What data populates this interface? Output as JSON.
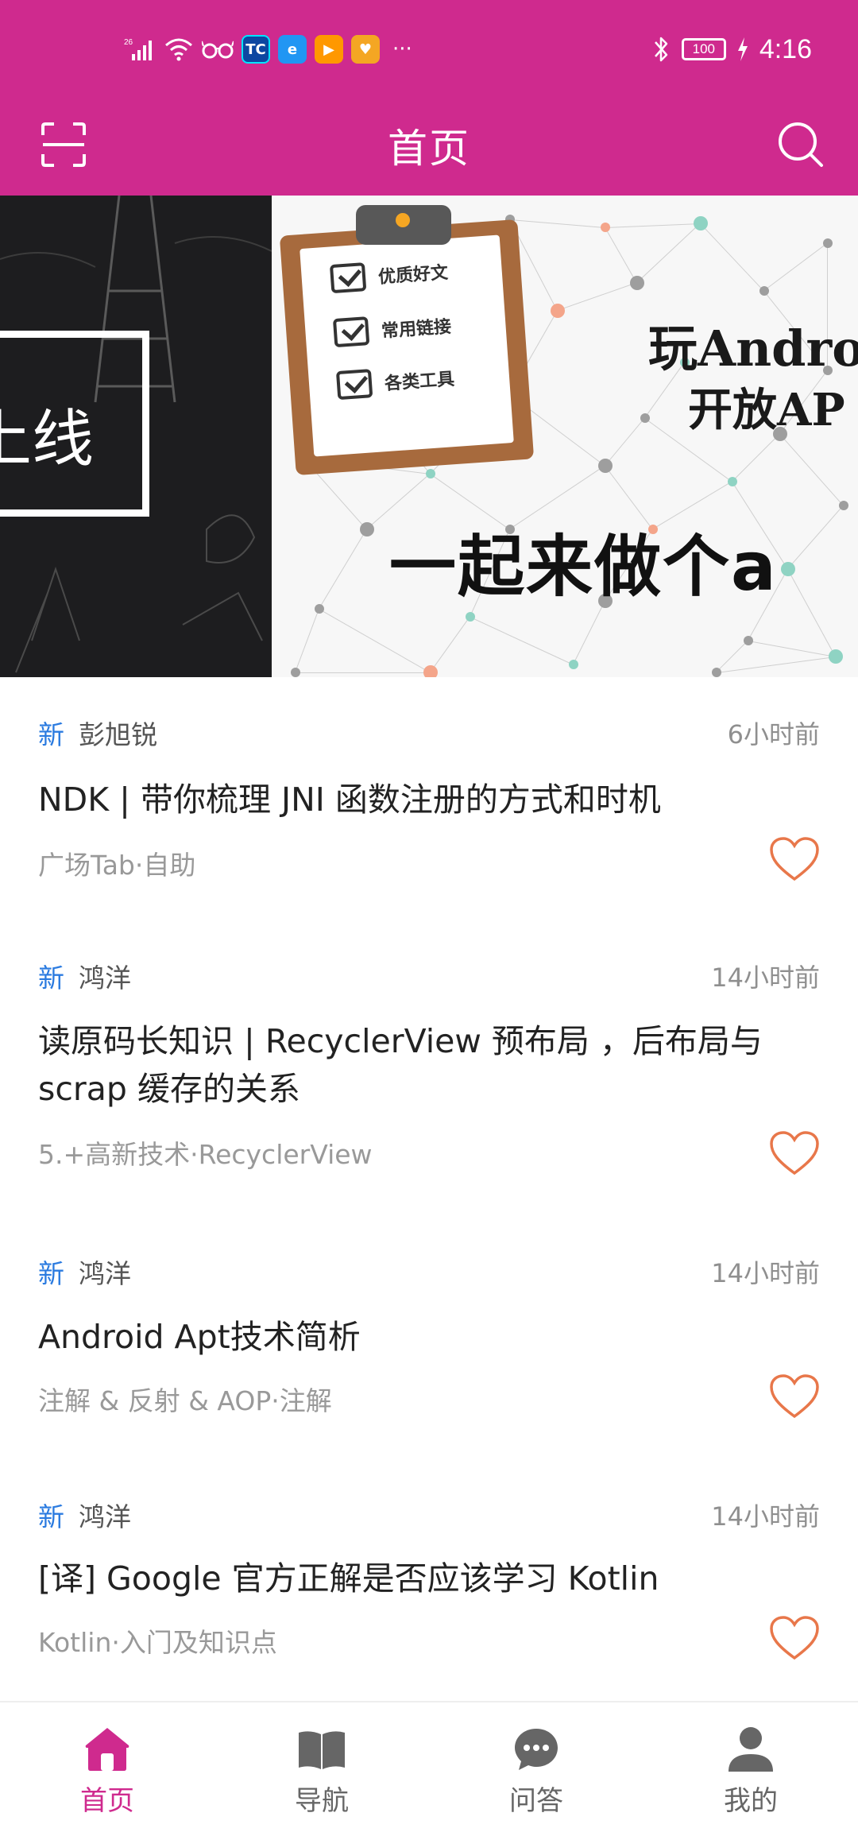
{
  "theme": {
    "accent": "#cf2a8e",
    "new_tag_color": "#2b7be0",
    "heart_color": "#e8774a"
  },
  "status_bar": {
    "network": "26",
    "apps": [
      {
        "icon": "tc-app-icon",
        "label": "TC",
        "color": "#1565c0"
      },
      {
        "icon": "browser-app-icon",
        "label": "e",
        "color": "#2196f3"
      },
      {
        "icon": "play-app-icon",
        "label": "▶",
        "color": "#ff9800"
      },
      {
        "icon": "shield-app-icon",
        "label": "♥",
        "color": "#f4a623"
      }
    ],
    "more": "···",
    "battery": "100",
    "time": "4:16"
  },
  "title_bar": {
    "title": "首页"
  },
  "banner": {
    "left_text": "上线",
    "right_title_line1": "玩Androi",
    "right_title_line2": "开放AP",
    "slogan": "一起来做个a",
    "checklist": [
      "优质好文",
      "常用链接",
      "各类工具"
    ]
  },
  "articles": [
    {
      "tag": "新",
      "author": "彭旭锐",
      "time": "6小时前",
      "title": "NDK | 带你梳理 JNI 函数注册的方式和时机",
      "category": "广场Tab·自助",
      "favorited": false
    },
    {
      "tag": "新",
      "author": "鸿洋",
      "time": "14小时前",
      "title": "读原码长知识 | RecyclerView 预布局 ，后布局与 scrap 缓存的关系",
      "category": "5.+高新技术·RecyclerView",
      "favorited": false
    },
    {
      "tag": "新",
      "author": "鸿洋",
      "time": "14小时前",
      "title": "Android Apt技术简析",
      "category": "注解 & 反射 & AOP·注解",
      "favorited": false
    },
    {
      "tag": "新",
      "author": "鸿洋",
      "time": "14小时前",
      "title": "[译] Google 官方正解是否应该学习 Kotlin",
      "category": "Kotlin·入门及知识点",
      "favorited": false
    }
  ],
  "bottom_nav": [
    {
      "label": "首页",
      "icon": "home-icon",
      "active": true
    },
    {
      "label": "导航",
      "icon": "book-icon",
      "active": false
    },
    {
      "label": "问答",
      "icon": "chat-icon",
      "active": false
    },
    {
      "label": "我的",
      "icon": "user-icon",
      "active": false
    }
  ]
}
